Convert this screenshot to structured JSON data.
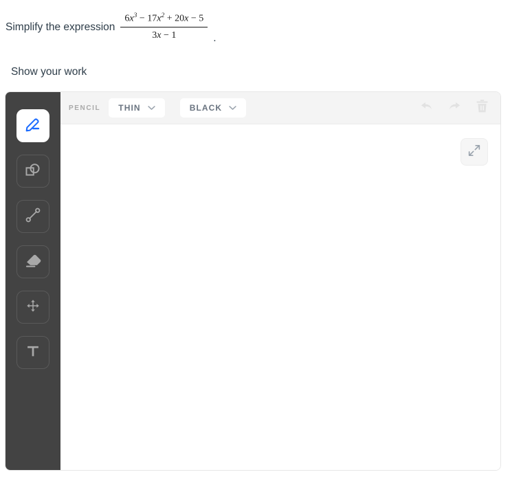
{
  "question": {
    "prompt_prefix": "Simplify the expression",
    "prompt_suffix": ".",
    "expression": {
      "numerator_plain": "6x^3 - 17x^2 + 20x - 5",
      "denominator_plain": "3x - 1",
      "numerator": {
        "t1": "6",
        "t1_var": "x",
        "t1_exp": "3",
        "op1": "−",
        "t2": "17",
        "t2_var": "x",
        "t2_exp": "2",
        "op2": "+",
        "t3": "20",
        "t3_var": "x",
        "op3": "−",
        "t4": "5"
      },
      "denominator": {
        "d1": "3",
        "d1_var": "x",
        "dop": "−",
        "d2": "1"
      }
    },
    "sub_prompt": "Show your work"
  },
  "whiteboard": {
    "tools": [
      {
        "name": "pencil",
        "icon": "pencil-icon",
        "active": true
      },
      {
        "name": "shapes",
        "icon": "shapes-icon",
        "active": false
      },
      {
        "name": "line",
        "icon": "line-segment-icon",
        "active": false
      },
      {
        "name": "eraser",
        "icon": "eraser-icon",
        "active": false
      },
      {
        "name": "move",
        "icon": "move-icon",
        "active": false
      },
      {
        "name": "text",
        "icon": "text-icon",
        "active": false
      }
    ],
    "toolbar": {
      "tool_label": "PENCIL",
      "thickness_value": "THIN",
      "color_value": "BLACK",
      "undo_icon": "undo-icon",
      "redo_icon": "redo-icon",
      "clear_icon": "trash-icon"
    },
    "canvas": {
      "expand_icon": "expand-icon",
      "content": ""
    }
  },
  "colors": {
    "rail_background": "#434343",
    "toolbar_background": "#f4f4f4",
    "active_tool_icon": "#1a6bff",
    "tool_icon": "#a8a8a8",
    "disabled_icon": "#e2e2e2",
    "pill_text": "#6a7480",
    "body_text": "#2e3d49"
  }
}
